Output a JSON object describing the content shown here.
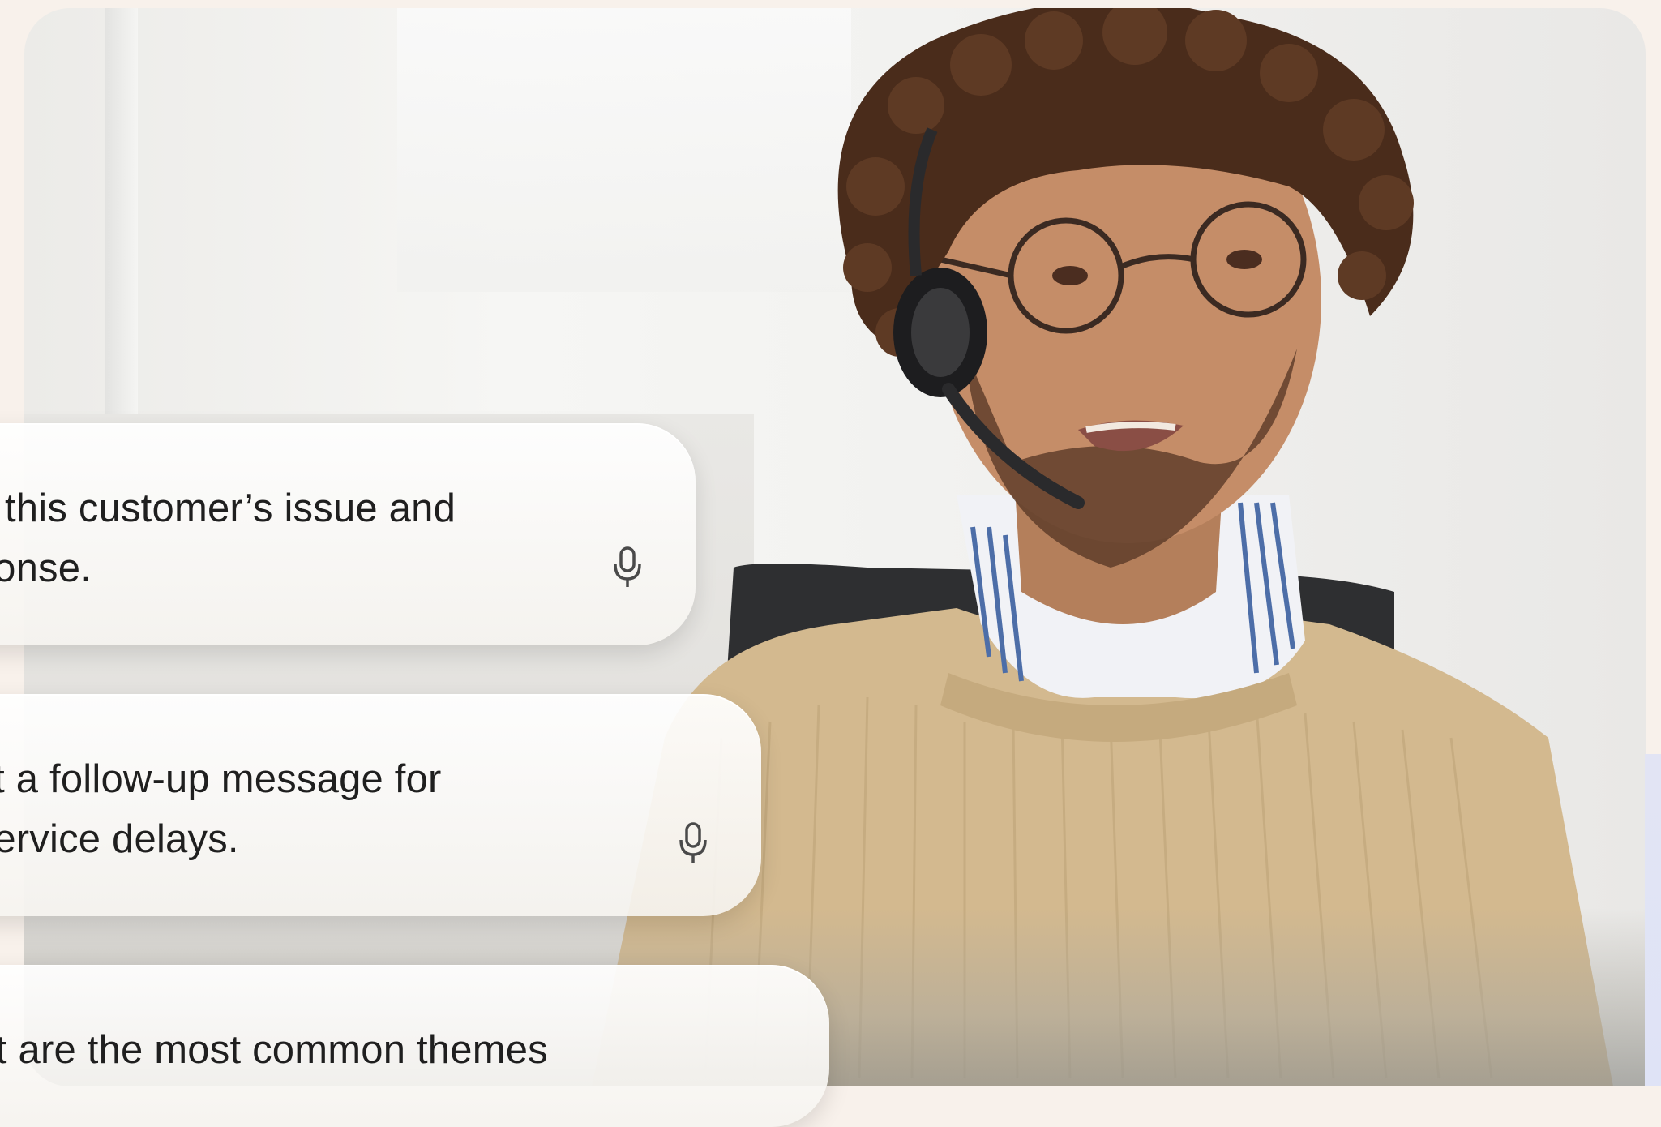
{
  "prompts": [
    {
      "text": "ze this customer’s issue and\nsponse.",
      "icon": "microphone-icon"
    },
    {
      "text": "est a follow-up message for\nt service delays.",
      "icon": "microphone-icon"
    },
    {
      "text": "hat are the most common themes",
      "icon": "microphone-icon"
    }
  ],
  "colors": {
    "page_background": "#f8f1eb",
    "card_text": "#1f1f1f",
    "icon": "#4a4a4a",
    "sweater": "#d3b98f",
    "shirt_stripe": "#4d6ea8"
  }
}
